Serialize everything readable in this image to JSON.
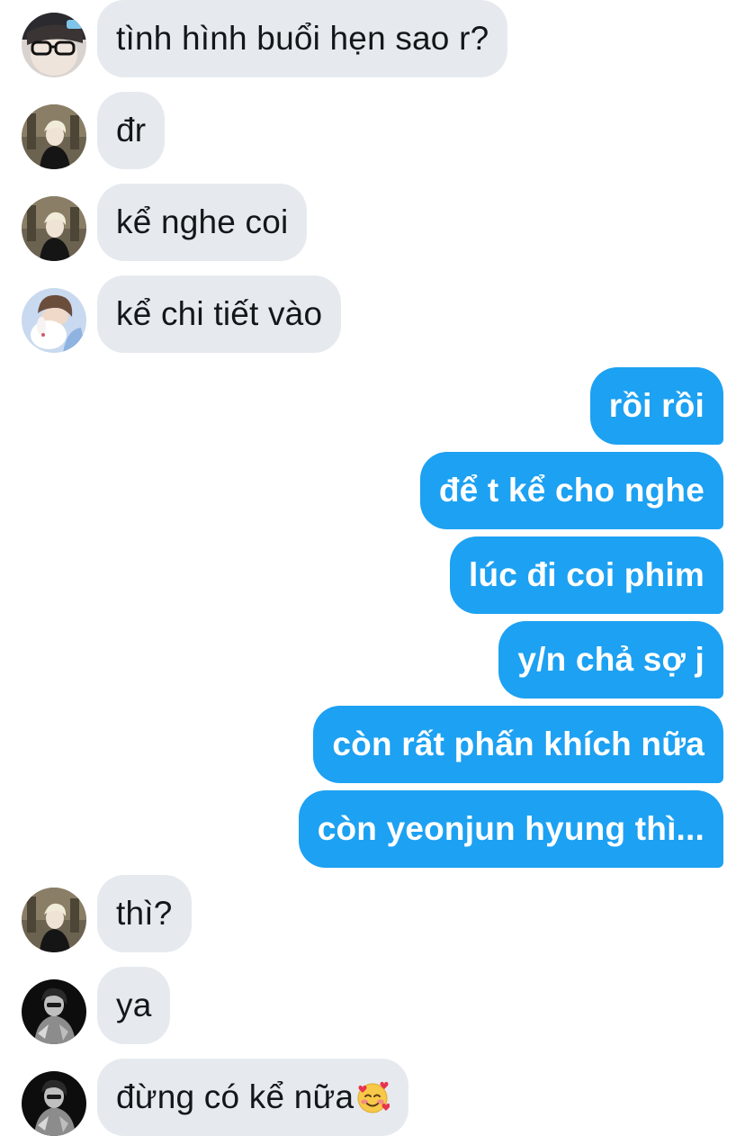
{
  "conversation": {
    "messages": [
      {
        "side": "in",
        "avatar": "user-glasses",
        "text": "tình hình buổi hẹn sao r?"
      },
      {
        "side": "in",
        "avatar": "user-blond",
        "text": "đr"
      },
      {
        "side": "in",
        "avatar": "user-blond",
        "text": "kể nghe coi"
      },
      {
        "side": "in",
        "avatar": "user-bunny",
        "text": "kể chi tiết vào"
      },
      {
        "side": "out",
        "text": "rồi rồi "
      },
      {
        "side": "out",
        "text": "để t kể cho nghe"
      },
      {
        "side": "out",
        "text": "lúc đi coi phim "
      },
      {
        "side": "out",
        "text": "y/n chả sợ j"
      },
      {
        "side": "out",
        "text": "còn rất phấn khích nữa"
      },
      {
        "side": "out",
        "text": "còn yeonjun hyung thì..."
      },
      {
        "side": "in",
        "avatar": "user-blond",
        "text": "thì?"
      },
      {
        "side": "in",
        "avatar": "user-dark",
        "text": "ya"
      },
      {
        "side": "in",
        "avatar": "user-dark",
        "text": "đừng có kể nữa",
        "emoji": "smiling-face-with-hearts"
      }
    ]
  },
  "colors": {
    "incoming_bubble": "#e6eaee",
    "outgoing_bubble": "#1da1f2",
    "incoming_text": "#14171a",
    "outgoing_text": "#ffffff"
  }
}
